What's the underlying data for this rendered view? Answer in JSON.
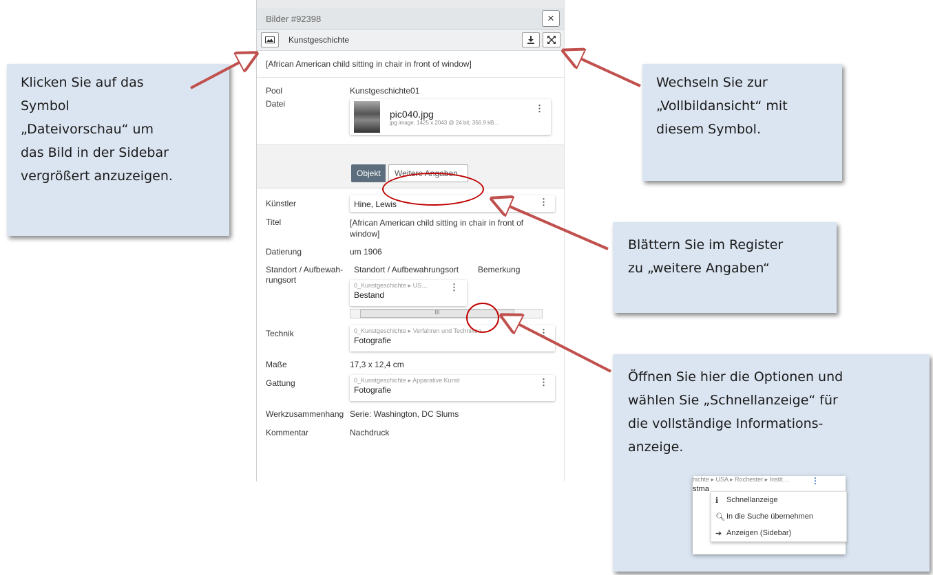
{
  "callouts": {
    "preview": [
      "Klicken Sie auf das",
      "Symbol",
      "„Dateivorschau“ um",
      "das Bild in der Sidebar",
      "vergrößert anzuzeigen."
    ],
    "fullscreen": [
      "Wechseln Sie zur",
      "„Vollbildansicht“ mit",
      "diesem Symbol."
    ],
    "tab": [
      "Blättern Sie im Register",
      "zu „weitere Angaben“"
    ],
    "options": [
      "Öffnen Sie hier die Optionen und",
      "wählen Sie „Schnellanzeige“ für",
      "die vollständige Informations-",
      "anzeige."
    ]
  },
  "panel": {
    "title": "Bilder #92398",
    "close_icon": "×",
    "toolbar_label": "Kunstgeschichte",
    "caption": "[African American child sitting in chair in front of window]",
    "pool_label": "Pool",
    "pool_value": "Kunstgeschichte01",
    "file_label": "Datei",
    "file_name": "pic040.jpg",
    "file_meta": "jpg image,  1425 x 2043 @ 24 bit,  356.9 kB…",
    "tabs": {
      "objekt": "Objekt",
      "weitere": "Weitere Angaben"
    },
    "kuenstler_label": "Künstler",
    "kuenstler_value": "Hine, Lewis",
    "titel_label": "Titel",
    "titel_value": "[African American child sitting in chair in front of window]",
    "datierung_label": "Datierung",
    "datierung_value": "um 1906",
    "standort_label": "Standort / Aufbewah-rungsort",
    "standort_col1": "Standort / Aufbewahrungsort",
    "standort_col2": "Bemerkung",
    "standort_crumb": "0_Kunstgeschichte ▸ US…",
    "standort_value": "Bestand",
    "scroll_thumb": "III",
    "technik_label": "Technik",
    "technik_crumb": "0_Kunstgeschichte ▸ Verfahren und Techniken",
    "technik_value": "Fotografie",
    "masse_label": "Maße",
    "masse_value": "17,3 x 12,4 cm",
    "gattung_label": "Gattung",
    "gattung_crumb": "0_Kunstgeschichte ▸ Apparative Kunst",
    "gattung_value": "Fotografie",
    "werk_label": "Werkzusammenhang",
    "werk_value": "Serie: Washington, DC Slums",
    "kommentar_label": "Kommentar",
    "kommentar_value": "Nachdruck"
  },
  "context_menu": {
    "crumb": "hichte ▸ USA ▸ Rochester ▸ Instit…",
    "partial": "stma",
    "items": [
      "Schnellanzeige",
      "In die Suche übernehmen",
      "Anzeigen (Sidebar)"
    ]
  },
  "colors": {
    "callout_bg": "#dbe5f1",
    "arrow": "#c0504d",
    "ellipse": "#c00000",
    "active_tab": "#5c6e7e"
  },
  "icons": [
    "image-icon",
    "download-icon",
    "expand-icon",
    "close-icon",
    "kebab-icon",
    "info-icon",
    "search-icon",
    "arrow-circle-icon"
  ]
}
